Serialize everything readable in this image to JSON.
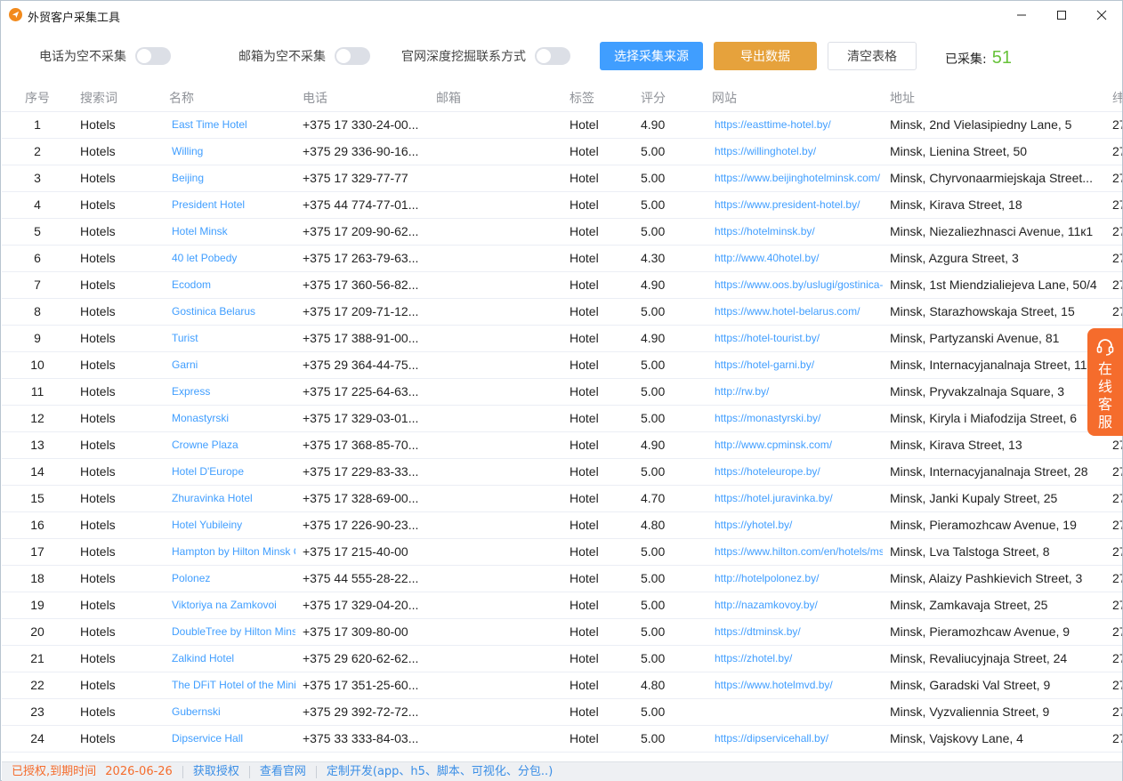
{
  "window": {
    "title": "外贸客户采集工具",
    "icon": "paper-plane-icon"
  },
  "toolbar": {
    "toggles": [
      {
        "label": "电话为空不采集",
        "on": false
      },
      {
        "label": "邮箱为空不采集",
        "on": false
      },
      {
        "label": "官网深度挖掘联系方式",
        "on": false
      }
    ],
    "select_source_label": "选择采集来源",
    "export_label": "导出数据",
    "clear_label": "清空表格",
    "collected_label": "已采集:",
    "collected_count": "51"
  },
  "table": {
    "columns": [
      "序号",
      "搜索词",
      "名称",
      "电话",
      "邮箱",
      "标签",
      "评分",
      "网站",
      "地址",
      "纬"
    ],
    "rows": [
      {
        "idx": "1",
        "kw": "Hotels",
        "name": "East Time Hotel",
        "phone": "+375 17 330-24-00...",
        "email": "",
        "tag": "Hotel",
        "score": "4.90",
        "site": "https://easttime-hotel.by/",
        "addr": "Minsk, 2nd Vielasipiedny Lane, 5",
        "extra": "27"
      },
      {
        "idx": "2",
        "kw": "Hotels",
        "name": "Willing",
        "phone": "+375 29 336-90-16...",
        "email": "",
        "tag": "Hotel",
        "score": "5.00",
        "site": "https://willinghotel.by/",
        "addr": "Minsk, Lienina Street, 50",
        "extra": "27"
      },
      {
        "idx": "3",
        "kw": "Hotels",
        "name": "Beijing",
        "phone": "+375 17 329-77-77",
        "email": "",
        "tag": "Hotel",
        "score": "5.00",
        "site": "https://www.beijinghotelminsk.com/",
        "addr": "Minsk, Chyrvonaarmiejskaja Street...",
        "extra": "27"
      },
      {
        "idx": "4",
        "kw": "Hotels",
        "name": "President Hotel",
        "phone": "+375 44 774-77-01...",
        "email": "",
        "tag": "Hotel",
        "score": "5.00",
        "site": "https://www.president-hotel.by/",
        "addr": "Minsk, Kirava Street, 18",
        "extra": "27"
      },
      {
        "idx": "5",
        "kw": "Hotels",
        "name": "Hotel Minsk",
        "phone": "+375 17 209-90-62...",
        "email": "",
        "tag": "Hotel",
        "score": "5.00",
        "site": "https://hotelminsk.by/",
        "addr": "Minsk, Niezaliezhnasci Avenue, 11к1",
        "extra": "27"
      },
      {
        "idx": "6",
        "kw": "Hotels",
        "name": "40 let Pobedy",
        "phone": "+375 17 263-79-63...",
        "email": "",
        "tag": "Hotel",
        "score": "4.30",
        "site": "http://www.40hotel.by/",
        "addr": "Minsk, Azgura Street, 3",
        "extra": "27"
      },
      {
        "idx": "7",
        "kw": "Hotels",
        "name": "Ecodom",
        "phone": "+375 17 360-56-82...",
        "email": "",
        "tag": "Hotel",
        "score": "4.90",
        "site": "https://www.oos.by/uslugi/gostinica-",
        "addr": "Minsk, 1st Miendzialiejeva Lane, 50/4",
        "extra": "27"
      },
      {
        "idx": "8",
        "kw": "Hotels",
        "name": "Gostinica Belarus",
        "phone": "+375 17 209-71-12...",
        "email": "",
        "tag": "Hotel",
        "score": "5.00",
        "site": "https://www.hotel-belarus.com/",
        "addr": "Minsk, Starazhowskaja Street, 15",
        "extra": "27"
      },
      {
        "idx": "9",
        "kw": "Hotels",
        "name": "Turist",
        "phone": "+375 17 388-91-00...",
        "email": "",
        "tag": "Hotel",
        "score": "4.90",
        "site": "https://hotel-tourist.by/",
        "addr": "Minsk, Partyzanski Avenue, 81",
        "extra": "27"
      },
      {
        "idx": "10",
        "kw": "Hotels",
        "name": "Garni",
        "phone": "+375 29 364-44-75...",
        "email": "",
        "tag": "Hotel",
        "score": "5.00",
        "site": "https://hotel-garni.by/",
        "addr": "Minsk, Internacyjanalnaja Street, 11",
        "extra": "27"
      },
      {
        "idx": "11",
        "kw": "Hotels",
        "name": "Express",
        "phone": "+375 17 225-64-63...",
        "email": "",
        "tag": "Hotel",
        "score": "5.00",
        "site": "http://rw.by/",
        "addr": "Minsk, Pryvakzalnaja Square, 3",
        "extra": "27"
      },
      {
        "idx": "12",
        "kw": "Hotels",
        "name": "Monastyrski",
        "phone": "+375 17 329-03-01...",
        "email": "",
        "tag": "Hotel",
        "score": "5.00",
        "site": "https://monastyrski.by/",
        "addr": "Minsk, Kiryla i Miafodzija Street, 6",
        "extra": "27"
      },
      {
        "idx": "13",
        "kw": "Hotels",
        "name": "Crowne Plaza",
        "phone": "+375 17 368-85-70...",
        "email": "",
        "tag": "Hotel",
        "score": "4.90",
        "site": "http://www.cpminsk.com/",
        "addr": "Minsk, Kirava Street, 13",
        "extra": "27"
      },
      {
        "idx": "14",
        "kw": "Hotels",
        "name": "Hotel D'Europe",
        "phone": "+375 17 229-83-33...",
        "email": "",
        "tag": "Hotel",
        "score": "5.00",
        "site": "https://hoteleurope.by/",
        "addr": "Minsk, Internacyjanalnaja Street, 28",
        "extra": "27"
      },
      {
        "idx": "15",
        "kw": "Hotels",
        "name": "Zhuravinka Hotel",
        "phone": "+375 17 328-69-00...",
        "email": "",
        "tag": "Hotel",
        "score": "4.70",
        "site": "https://hotel.juravinka.by/",
        "addr": "Minsk, Janki Kupaly Street, 25",
        "extra": "27"
      },
      {
        "idx": "16",
        "kw": "Hotels",
        "name": "Hotel Yubileiny",
        "phone": "+375 17 226-90-23...",
        "email": "",
        "tag": "Hotel",
        "score": "4.80",
        "site": "https://yhotel.by/",
        "addr": "Minsk, Pieramozhcaw Avenue, 19",
        "extra": "27"
      },
      {
        "idx": "17",
        "kw": "Hotels",
        "name": "Hampton by Hilton Minsk C",
        "phone": "+375 17 215-40-00",
        "email": "",
        "tag": "Hotel",
        "score": "5.00",
        "site": "https://www.hilton.com/en/hotels/ms",
        "addr": "Minsk, Lva Talstoga Street, 8",
        "extra": "27"
      },
      {
        "idx": "18",
        "kw": "Hotels",
        "name": "Polonez",
        "phone": "+375 44 555-28-22...",
        "email": "",
        "tag": "Hotel",
        "score": "5.00",
        "site": "http://hotelpolonez.by/",
        "addr": "Minsk, Alaizy Pashkievich Street, 3",
        "extra": "27"
      },
      {
        "idx": "19",
        "kw": "Hotels",
        "name": "Viktoriya na Zamkovoi",
        "phone": "+375 17 329-04-20...",
        "email": "",
        "tag": "Hotel",
        "score": "5.00",
        "site": "http://nazamkovoy.by/",
        "addr": "Minsk, Zamkavaja Street, 25",
        "extra": "27"
      },
      {
        "idx": "20",
        "kw": "Hotels",
        "name": "DoubleTree by Hilton Mins",
        "phone": "+375 17 309-80-00",
        "email": "",
        "tag": "Hotel",
        "score": "5.00",
        "site": "https://dtminsk.by/",
        "addr": "Minsk, Pieramozhcaw Avenue, 9",
        "extra": "27"
      },
      {
        "idx": "21",
        "kw": "Hotels",
        "name": "Zalkind Hotel",
        "phone": "+375 29 620-62-62...",
        "email": "",
        "tag": "Hotel",
        "score": "5.00",
        "site": "https://zhotel.by/",
        "addr": "Minsk, Revaliucyjnaja Street, 24",
        "extra": "27"
      },
      {
        "idx": "22",
        "kw": "Hotels",
        "name": "The DFiT Hotel of the Mini",
        "phone": "+375 17 351-25-60...",
        "email": "",
        "tag": "Hotel",
        "score": "4.80",
        "site": "https://www.hotelmvd.by/",
        "addr": "Minsk, Garadski Val Street, 9",
        "extra": "27"
      },
      {
        "idx": "23",
        "kw": "Hotels",
        "name": "Gubernski",
        "phone": "+375 29 392-72-72...",
        "email": "",
        "tag": "Hotel",
        "score": "5.00",
        "site": "",
        "addr": "Minsk, Vyzvaliennia Street, 9",
        "extra": "27"
      },
      {
        "idx": "24",
        "kw": "Hotels",
        "name": "Dipservice Hall",
        "phone": "+375 33 333-84-03...",
        "email": "",
        "tag": "Hotel",
        "score": "5.00",
        "site": "https://dipservicehall.by/",
        "addr": "Minsk, Vajskovy Lane, 4",
        "extra": "27"
      }
    ]
  },
  "float_service": {
    "icon": "headset-icon",
    "label": "在线客服"
  },
  "statusbar": {
    "license": "已授权,到期时间",
    "expiry": "2026-06-26",
    "get_license": "获取授权",
    "official_site": "查看官网",
    "custom_dev": "定制开发(app、h5、脚本、可视化、分包..)"
  },
  "colors": {
    "primary": "#409eff",
    "warning": "#e6a23c",
    "success": "#67c23a",
    "accent_orange": "#f56c2c"
  }
}
